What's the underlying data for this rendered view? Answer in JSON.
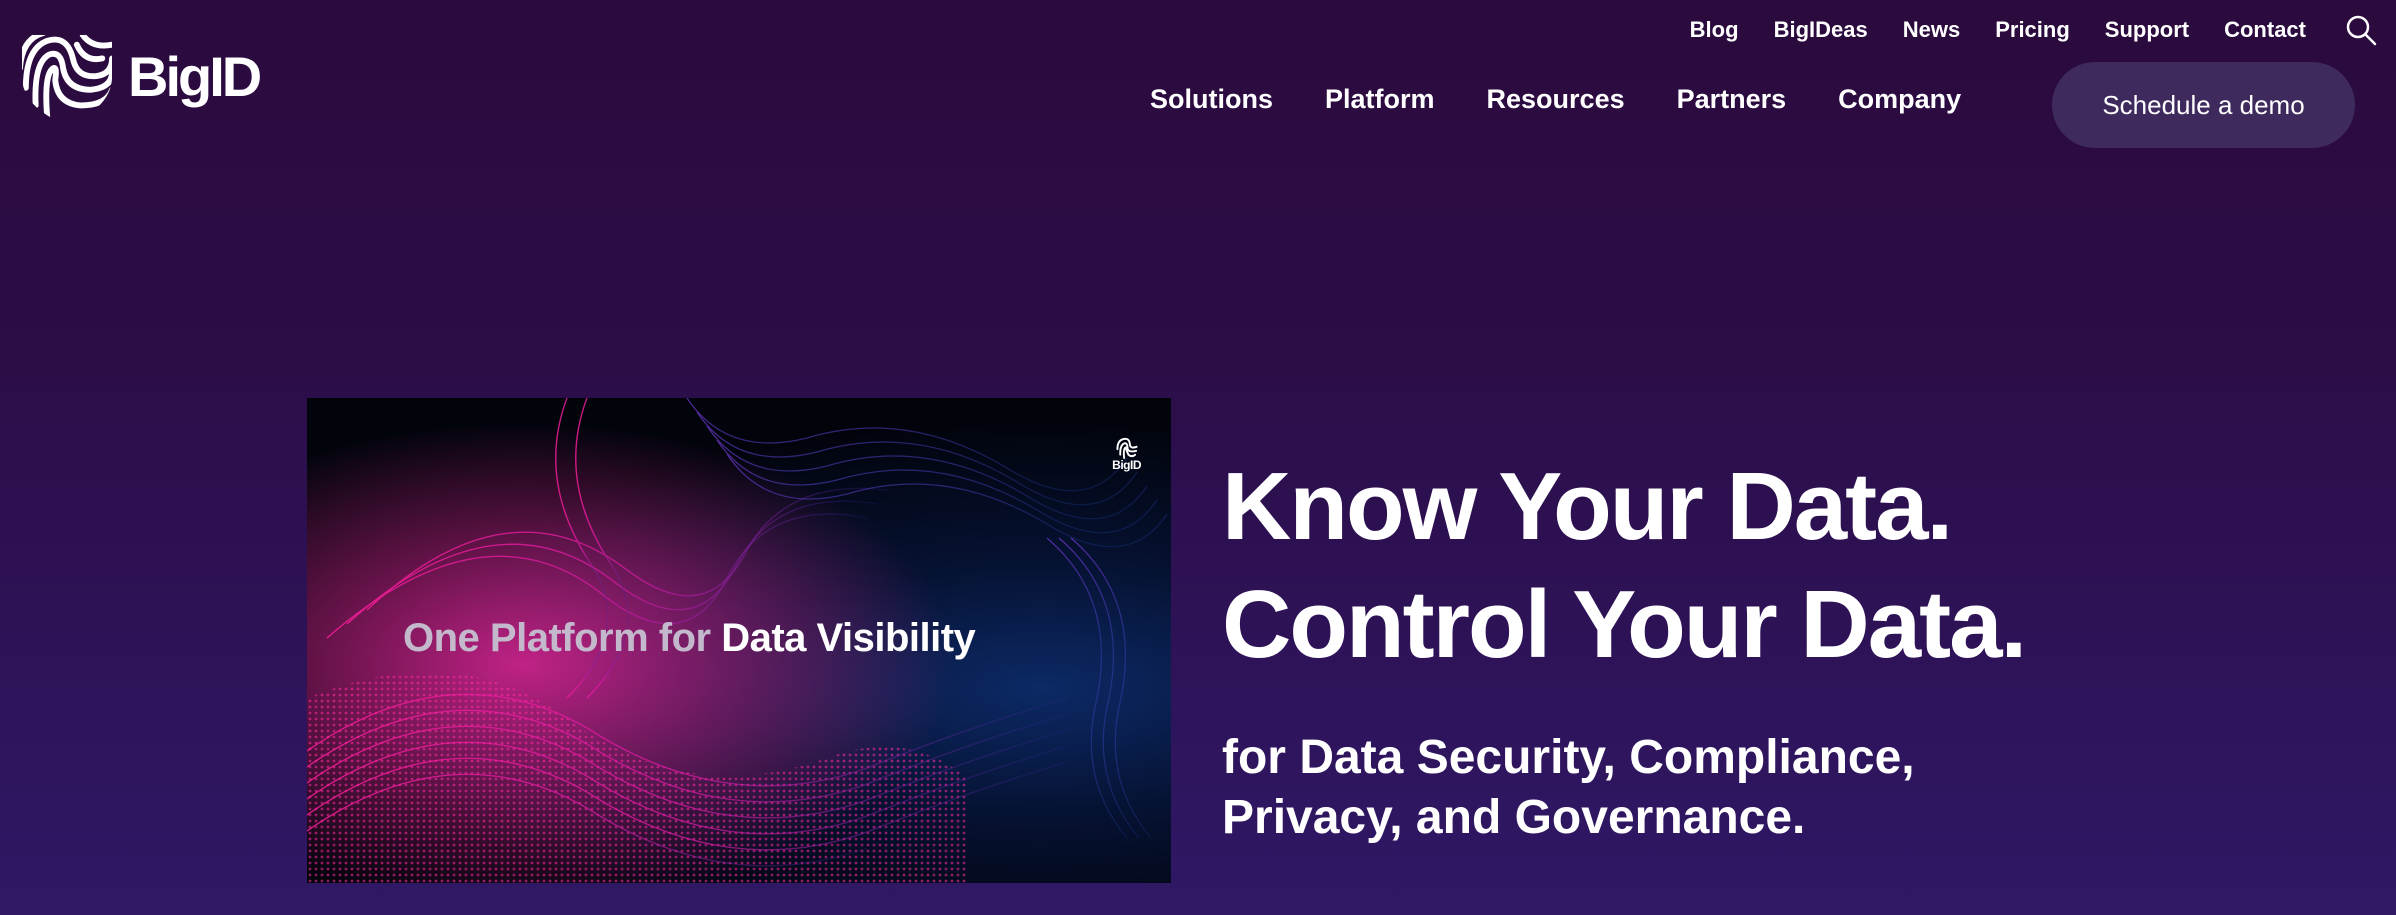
{
  "brand": {
    "name": "BigID"
  },
  "utility_nav": [
    {
      "label": "Blog"
    },
    {
      "label": "BigIDeas"
    },
    {
      "label": "News"
    },
    {
      "label": "Pricing"
    },
    {
      "label": "Support"
    },
    {
      "label": "Contact"
    }
  ],
  "main_nav": [
    {
      "label": "Solutions"
    },
    {
      "label": "Platform"
    },
    {
      "label": "Resources"
    },
    {
      "label": "Partners"
    },
    {
      "label": "Company"
    }
  ],
  "cta": {
    "label": "Schedule a demo"
  },
  "video": {
    "title_part1": "One Platform for",
    "title_part2": "Data Visibility",
    "logo_text": "BigID"
  },
  "hero": {
    "headline_line1": "Know Your Data.",
    "headline_line2": "Control Your Data.",
    "subhead_line1": "for Data Security, Compliance,",
    "subhead_line2": "Privacy, and Governance."
  },
  "icons": {
    "search": "search-icon",
    "logo": "fingerprint-shield-icon"
  },
  "colors": {
    "background_top": "#2b0a3d",
    "background_bottom": "#2f1866",
    "cta_bg": "#3e2a5c",
    "accent_pink": "#ff1e9c"
  }
}
